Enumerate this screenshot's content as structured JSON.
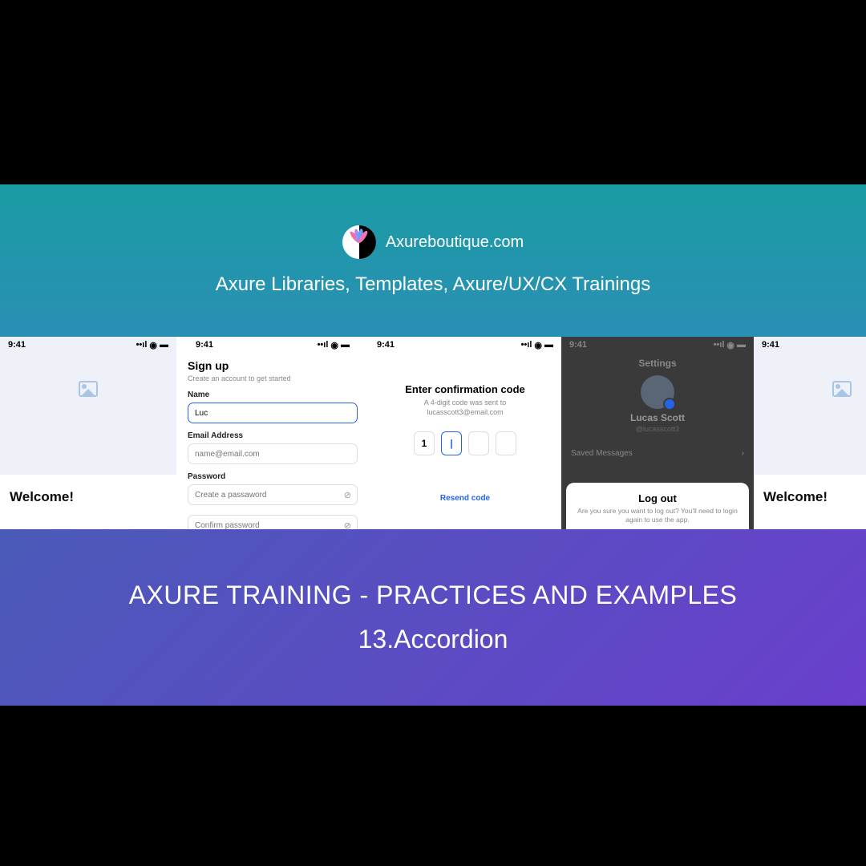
{
  "brand": {
    "name": "Axureboutique.com",
    "tagline": "Axure Libraries, Templates,  Axure/UX/CX Trainings"
  },
  "status_time": "9:41",
  "screen1": {
    "welcome": "Welcome!"
  },
  "screen2": {
    "title": "Sign up",
    "subtitle": "Create an account to get started",
    "name_label": "Name",
    "name_value": "Luc",
    "email_label": "Email Address",
    "email_placeholder": "name@email.com",
    "password_label": "Password",
    "password_placeholder": "Create a passaword",
    "confirm_placeholder": "Confirm password"
  },
  "screen3": {
    "title": "Enter confirmation code",
    "subtitle_line1": "A 4-digit code was sent to",
    "subtitle_line2": "lucasscott3@email.com",
    "code_digit1": "1",
    "resend": "Resend code"
  },
  "screen4": {
    "settings": "Settings",
    "user_name": "Lucas Scott",
    "user_handle": "@lucasscott3",
    "saved": "Saved Messages",
    "logout_title": "Log out",
    "logout_text": "Are you sure you want to log out? You'll need to login again to use the app."
  },
  "screen5": {
    "welcome": "Welcome!"
  },
  "footer": {
    "title": "AXURE TRAINING - PRACTICES AND EXAMPLES",
    "subtitle": "13.Accordion"
  }
}
